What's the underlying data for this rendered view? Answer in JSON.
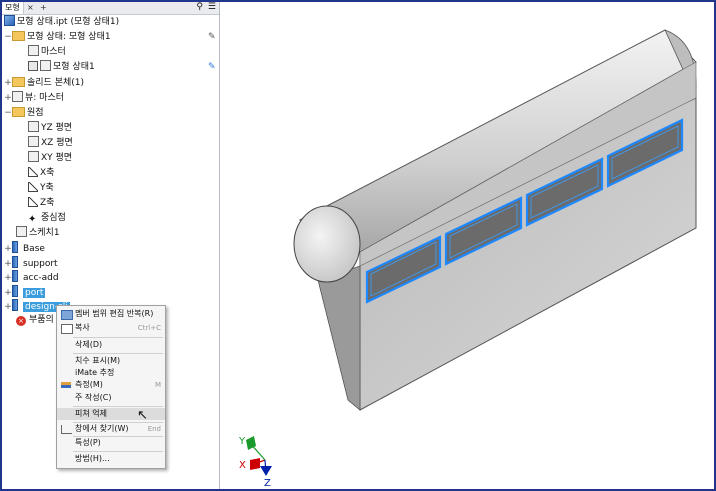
{
  "browser": {
    "tabs": {
      "model": "모형",
      "close": "×",
      "add": "+"
    },
    "tree": [
      {
        "label": "모형 상태.ipt (모형 상태1)"
      },
      {
        "label": "모형 상태: 모형 상태1"
      },
      {
        "label": "마스터"
      },
      {
        "label": "모형 상태1"
      },
      {
        "label": "솔리드 본체(1)"
      },
      {
        "label": "뷰: 마스터"
      },
      {
        "label": "원점"
      },
      {
        "label": "YZ 평면"
      },
      {
        "label": "XZ 평면"
      },
      {
        "label": "XY 평면"
      },
      {
        "label": "X축"
      },
      {
        "label": "Y축"
      },
      {
        "label": "Z축"
      },
      {
        "label": "중심점"
      },
      {
        "label": "스케치1"
      },
      {
        "label": "Base"
      },
      {
        "label": "support"
      },
      {
        "label": "acc-add"
      },
      {
        "label": "port"
      },
      {
        "label": "design-sli"
      },
      {
        "label": "부품의 끝"
      }
    ]
  },
  "context_menu": {
    "items": [
      {
        "label": "멤버 범위 편집 반복(R)",
        "shortcut": ""
      },
      {
        "label": "복사",
        "shortcut": "Ctrl+C"
      },
      {
        "label": "삭제(D)",
        "shortcut": ""
      },
      {
        "label": "치수 표시(M)",
        "shortcut": ""
      },
      {
        "label": "iMate 추정",
        "shortcut": ""
      },
      {
        "label": "측정(M)",
        "shortcut": "M"
      },
      {
        "label": "주 작성(C)",
        "shortcut": ""
      },
      {
        "label": "피쳐 억제",
        "shortcut": ""
      },
      {
        "label": "창에서 찾기(W)",
        "shortcut": "End"
      },
      {
        "label": "특성(P)",
        "shortcut": ""
      },
      {
        "label": "방법(H)...",
        "shortcut": ""
      }
    ]
  },
  "triad": {
    "x": "X",
    "y": "Y",
    "z": "Z"
  }
}
